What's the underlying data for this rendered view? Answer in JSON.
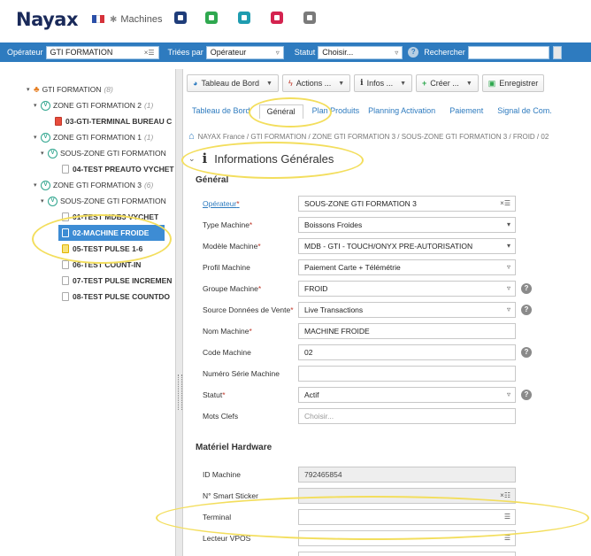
{
  "header": {
    "logo": "Nayax",
    "section": "Machines",
    "colors": {
      "brand": "#1a2a5a",
      "accent": "#2e7bbf",
      "selection": "#3d8cd4",
      "annotation": "#f3de5d"
    }
  },
  "filters": {
    "operator_label": "Opérateur",
    "operator_value": "GTI FORMATION",
    "sort_label": "Triées par",
    "sort_value": "Opérateur",
    "status_label": "Statut",
    "status_value": "Choisir...",
    "search_label": "Rechercher",
    "search_value": ""
  },
  "tree": {
    "items": [
      {
        "label": "GTI FORMATION",
        "count": "(8)"
      },
      {
        "label": "ZONE GTI FORMATION 2",
        "count": "(1)"
      },
      {
        "label": "03-GTI-TERMINAL BUREAU C",
        "count": ""
      },
      {
        "label": "ZONE GTI FORMATION 1",
        "count": "(1)"
      },
      {
        "label": "SOUS-ZONE GTI FORMATION",
        "count": ""
      },
      {
        "label": "04-TEST PREAUTO VYCHET",
        "count": ""
      },
      {
        "label": "ZONE GTI FORMATION 3",
        "count": "(6)"
      },
      {
        "label": "SOUS-ZONE GTI FORMATION",
        "count": ""
      },
      {
        "label": "01-TEST MDB3 VYCHET",
        "count": ""
      },
      {
        "label": "02-MACHINE FROIDE",
        "count": ""
      },
      {
        "label": "05-TEST PULSE 1-6",
        "count": ""
      },
      {
        "label": "06-TEST COUNT-IN",
        "count": ""
      },
      {
        "label": "07-TEST PULSE INCREMEN",
        "count": ""
      },
      {
        "label": "08-TEST PULSE COUNTDO",
        "count": ""
      }
    ]
  },
  "toolbar": {
    "dashboard": "Tableau de Bord",
    "actions": "Actions ...",
    "infos": "Infos ...",
    "create": "Créer ...",
    "save": "Enregistrer"
  },
  "tabs": [
    "Tableau de Bord",
    "Général",
    "Plan Produits",
    "Planning Activation",
    "Paiement",
    "Signal de Com."
  ],
  "breadcrumb": "NAYAX France / GTI FORMATION / ZONE GTI FORMATION 3 / SOUS-ZONE GTI FORMATION 3 / FROID / 02",
  "section_title": "Informations Générales",
  "general": {
    "title": "Général",
    "operator": {
      "label": "Opérateur",
      "value": "SOUS-ZONE GTI FORMATION 3"
    },
    "machine_type": {
      "label": "Type Machine",
      "value": "Boissons Froides"
    },
    "machine_model": {
      "label": "Modèle Machine",
      "value": "MDB - GTI - TOUCH/ONYX PRE-AUTORISATION"
    },
    "machine_profile": {
      "label": "Profil Machine",
      "value": "Paiement Carte + Télémétrie"
    },
    "machine_group": {
      "label": "Groupe Machine",
      "value": "FROID"
    },
    "sales_source": {
      "label": "Source Données de Vente",
      "value": "Live Transactions"
    },
    "machine_name": {
      "label": "Nom Machine",
      "value": "MACHINE FROIDE"
    },
    "machine_code": {
      "label": "Code Machine",
      "value": "02"
    },
    "serial": {
      "label": "Numéro Série Machine",
      "value": ""
    },
    "status": {
      "label": "Statut",
      "value": "Actif"
    },
    "keywords": {
      "label": "Mots Clefs",
      "placeholder": "Choisir..."
    }
  },
  "hardware": {
    "title": "Matériel Hardware",
    "machine_id": {
      "label": "ID Machine",
      "value": "792465854"
    },
    "smart_sticker": {
      "label": "N° Smart Sticker",
      "value": ""
    },
    "terminal": {
      "label": "Terminal",
      "value": ""
    },
    "vpos_reader": {
      "label": "Lecteur VPOS",
      "value": ""
    }
  }
}
